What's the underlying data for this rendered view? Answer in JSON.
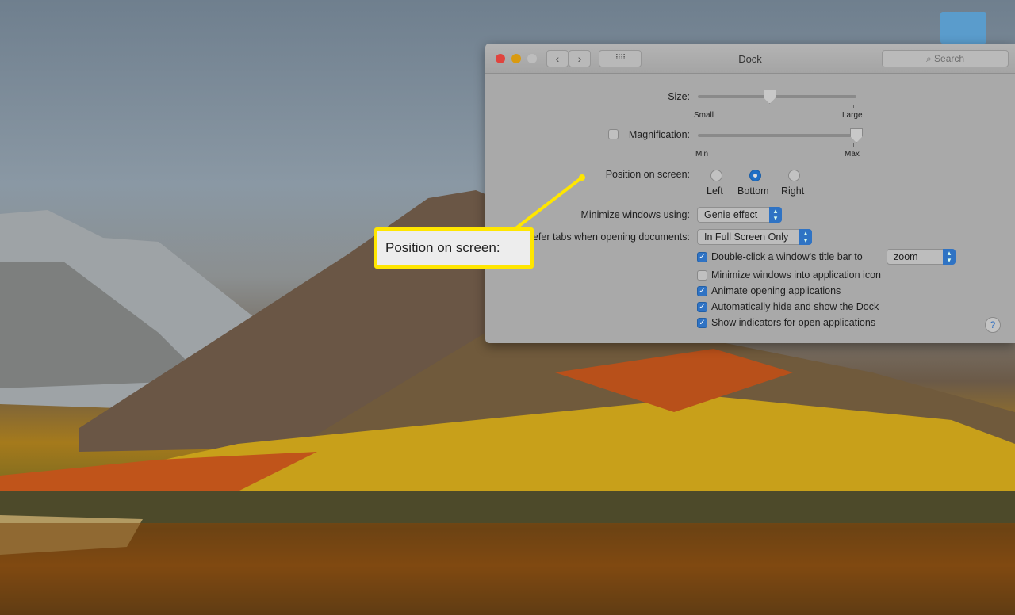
{
  "window": {
    "title": "Dock",
    "search_placeholder": "Search",
    "icons": {
      "back": "chevron-left-icon",
      "forward": "chevron-right-icon",
      "grid": "grid-icon",
      "search": "magnifier-icon",
      "help": "question-icon"
    },
    "traffic_lights": [
      "#e0443e",
      "#d99a10",
      "#bdbdbd"
    ]
  },
  "size": {
    "label": "Size:",
    "min_label": "Small",
    "max_label": "Large",
    "value": 0.43
  },
  "magnification": {
    "label": "Magnification:",
    "checked": false,
    "min_label": "Min",
    "max_label": "Max",
    "value": 1.0
  },
  "position": {
    "label": "Position on screen:",
    "options": [
      "Left",
      "Bottom",
      "Right"
    ],
    "selected": "Bottom"
  },
  "minimize": {
    "label": "Minimize windows using:",
    "value": "Genie effect"
  },
  "tabs": {
    "label": "Prefer tabs when opening documents:",
    "value": "In Full Screen Only"
  },
  "checkboxes": [
    {
      "label": "Double-click a window's title bar to",
      "checked": true,
      "popup": "zoom"
    },
    {
      "label": "Minimize windows into application icon",
      "checked": false
    },
    {
      "label": "Animate opening applications",
      "checked": true
    },
    {
      "label": "Automatically hide and show the Dock",
      "checked": true
    },
    {
      "label": "Show indicators for open applications",
      "checked": true
    }
  ],
  "help": "?",
  "callout": {
    "text": "Position on screen:",
    "color": "#ffe600"
  },
  "accent": "#2f73c4"
}
